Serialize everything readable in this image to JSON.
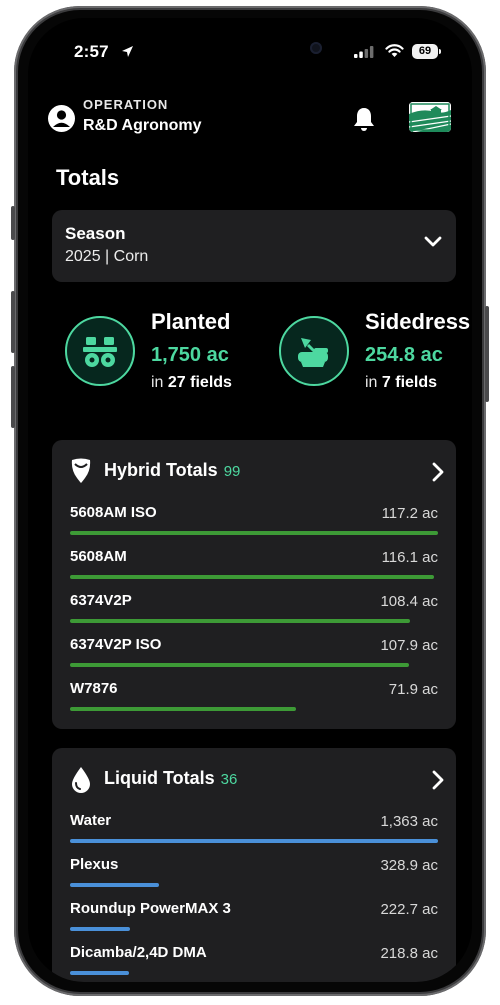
{
  "status_bar": {
    "time": "2:57",
    "battery": "69"
  },
  "header": {
    "operation_label": "OPERATION",
    "operation_name": "R&D Agronomy"
  },
  "page_title": "Totals",
  "season": {
    "label": "Season",
    "value": "2025 | Corn"
  },
  "stats": [
    {
      "title": "Planted",
      "value": "1,750 ac",
      "sub_prefix": "in",
      "sub_value": "27 fields",
      "icon": "planter-icon"
    },
    {
      "title": "Sidedress",
      "value": "254.8 ac",
      "sub_prefix": "in",
      "sub_value": "7 fields",
      "icon": "sidedress-icon"
    }
  ],
  "hybrid_totals": {
    "title": "Hybrid Totals",
    "count": "99",
    "bar_color": "#3d9a36",
    "rows": [
      {
        "name": "5608AM ISO",
        "value": "117.2 ac",
        "fraction": 1.0
      },
      {
        "name": "5608AM",
        "value": "116.1 ac",
        "fraction": 0.99
      },
      {
        "name": "6374V2P",
        "value": "108.4 ac",
        "fraction": 0.925
      },
      {
        "name": "6374V2P ISO",
        "value": "107.9 ac",
        "fraction": 0.92
      },
      {
        "name": "W7876",
        "value": "71.9 ac",
        "fraction": 0.614
      }
    ]
  },
  "liquid_totals": {
    "title": "Liquid Totals",
    "count": "36",
    "bar_color": "#4a90d9",
    "rows": [
      {
        "name": "Water",
        "value": "1,363 ac",
        "fraction": 1.0
      },
      {
        "name": "Plexus",
        "value": "328.9 ac",
        "fraction": 0.241
      },
      {
        "name": "Roundup PowerMAX 3",
        "value": "222.7 ac",
        "fraction": 0.163
      },
      {
        "name": "Dicamba/2,4D DMA",
        "value": "218.8 ac",
        "fraction": 0.161
      }
    ]
  },
  "colors": {
    "accent": "#4dd8a0",
    "card": "#1f1f21",
    "background": "#000000"
  }
}
